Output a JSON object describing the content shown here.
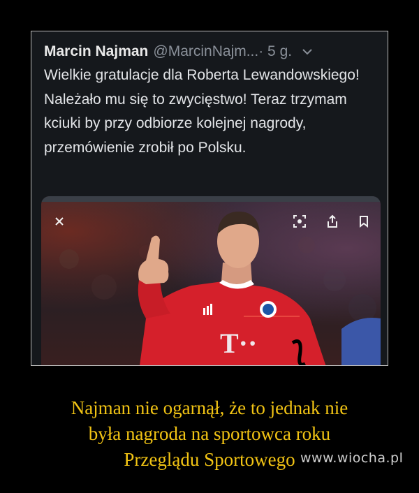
{
  "tweet": {
    "author_name": "Marcin Najman",
    "author_handle": "@MarcinNajm...",
    "time": "· 5 g.",
    "text": "Wielkie gratulacje dla Roberta Lewandowskiego! Należało mu się to zwycięstwo! Teraz trzymam kciuki by przy odbiorze kolejnej nagrody, przemówienie zrobił po Polsku.",
    "menu_icon": "chevron-down-icon"
  },
  "photo_viewer": {
    "close_icon": "close-icon",
    "lens_icon": "lens-icon",
    "share_icon": "share-icon",
    "bookmark_icon": "bookmark-icon",
    "jersey_logo": "T··"
  },
  "caption": {
    "lines": [
      "Najman nie ogarnął, że to jednak nie",
      "była nagroda na sportowca roku",
      "Przeglądu Sportowego"
    ]
  },
  "watermark": "www.wiocha.pl",
  "colors": {
    "caption": "#f2c414",
    "tweet_bg": "#15181c",
    "jersey_red": "#d5202b"
  }
}
